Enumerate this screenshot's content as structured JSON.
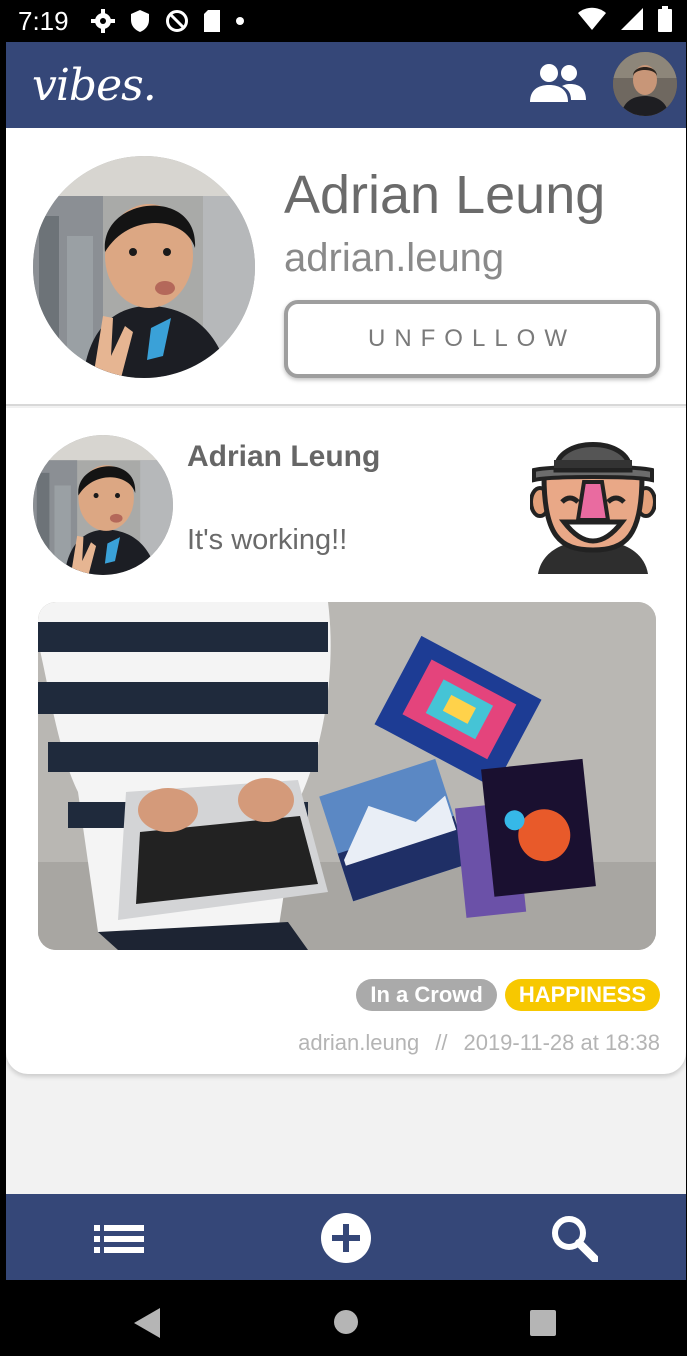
{
  "status_bar": {
    "time": "7:19"
  },
  "app_bar": {
    "logo": "vibes."
  },
  "profile": {
    "name": "Adrian Leung",
    "handle": "adrian.leung",
    "unfollow_label": "UNFOLLOW"
  },
  "post": {
    "author": "Adrian Leung",
    "text": "It's working!!",
    "tags": [
      "In a Crowd",
      "HAPPINESS"
    ],
    "meta_user": "adrian.leung",
    "meta_sep": "//",
    "meta_time": "2019-11-28 at 18:38"
  },
  "bottom_nav": {
    "items": [
      "list-icon",
      "add-icon",
      "search-icon"
    ]
  },
  "colors": {
    "brand": "#354778",
    "happiness": "#f7c800",
    "tag_grey": "#aaaaaa"
  }
}
